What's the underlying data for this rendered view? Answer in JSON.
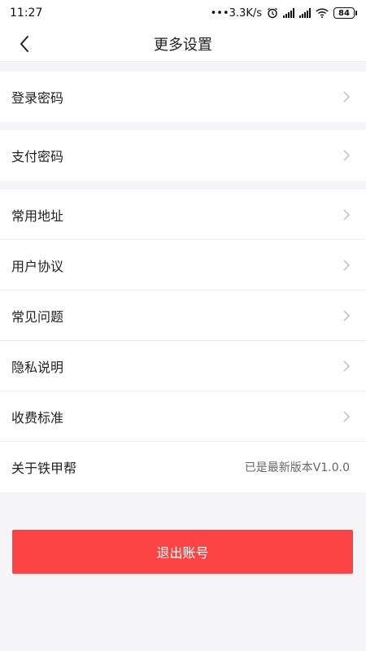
{
  "status_bar": {
    "time": "11:27",
    "network_speed": "•••3.3K/s",
    "battery": "84"
  },
  "header": {
    "title": "更多设置"
  },
  "settings": {
    "login_password": "登录密码",
    "pay_password": "支付密码",
    "items": [
      {
        "label": "常用地址"
      },
      {
        "label": "用户协议"
      },
      {
        "label": "常见问题"
      },
      {
        "label": "隐私说明"
      },
      {
        "label": "收费标准"
      }
    ],
    "about": {
      "label": "关于铁甲帮",
      "value": "已是最新版本V1.0.0"
    }
  },
  "logout_label": "退出账号",
  "colors": {
    "accent": "#fb4343",
    "background": "#f5f4f7"
  }
}
